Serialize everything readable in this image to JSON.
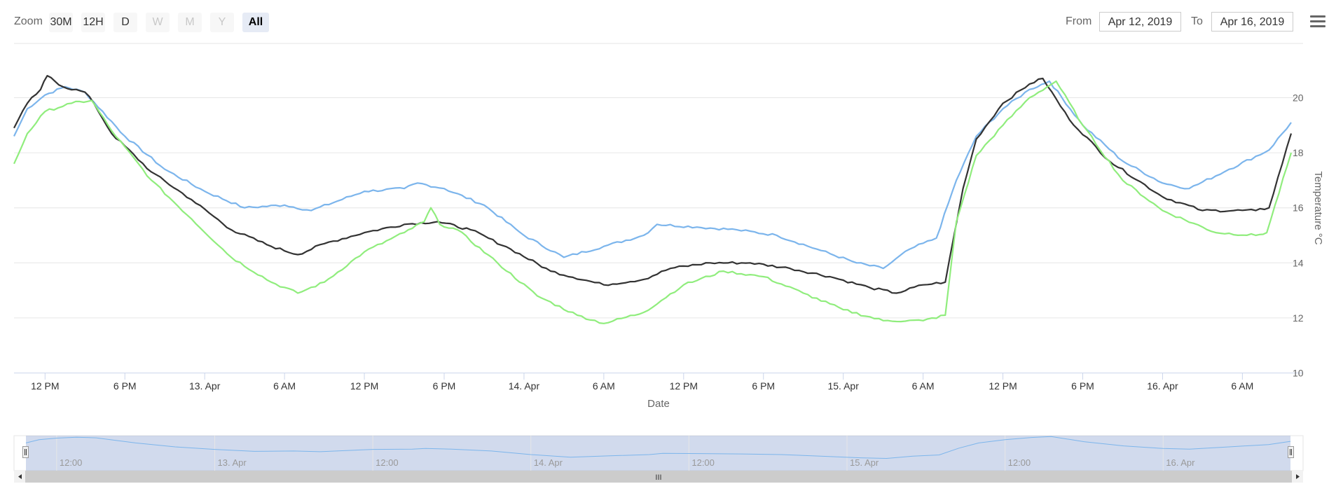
{
  "toolbar": {
    "zoom_label": "Zoom",
    "zoom_buttons": [
      "30M",
      "12H",
      "D",
      "W",
      "M",
      "Y",
      "All"
    ],
    "active_zoom": "All",
    "from_label": "From",
    "from_value": "Apr 12, 2019",
    "to_label": "To",
    "to_value": "Apr 16, 2019",
    "menu_icon": "hamburger-menu-icon"
  },
  "chart_data": {
    "type": "line",
    "xlabel": "Date",
    "ylabel": "Temperature °C",
    "xlim": [
      "2019-04-12T09:40",
      "2019-04-16T09:40"
    ],
    "ylim": [
      10,
      21
    ],
    "y_ticks": [
      10,
      12,
      14,
      16,
      18,
      20
    ],
    "x_tick_labels": [
      "12 PM",
      "6 PM",
      "13. Apr",
      "6 AM",
      "12 PM",
      "6 PM",
      "14. Apr",
      "6 AM",
      "12 PM",
      "6 PM",
      "15. Apr",
      "6 AM",
      "12 PM",
      "6 PM",
      "16. Apr",
      "6 AM"
    ],
    "grid": true,
    "legend": "none",
    "series": [
      {
        "color": "#7cb5ec",
        "points": [
          [
            "2019-04-12T09:40",
            18.6
          ],
          [
            "2019-04-12T10:40",
            19.6
          ],
          [
            "2019-04-12T12:00",
            20.1
          ],
          [
            "2019-04-12T13:30",
            20.4
          ],
          [
            "2019-04-12T15:00",
            20.2
          ],
          [
            "2019-04-12T18:00",
            18.6
          ],
          [
            "2019-04-12T21:00",
            17.4
          ],
          [
            "2019-04-13T00:00",
            16.6
          ],
          [
            "2019-04-13T03:00",
            16.0
          ],
          [
            "2019-04-13T06:00",
            16.1
          ],
          [
            "2019-04-13T08:00",
            15.9
          ],
          [
            "2019-04-13T12:00",
            16.6
          ],
          [
            "2019-04-13T15:00",
            16.7
          ],
          [
            "2019-04-13T16:00",
            16.9
          ],
          [
            "2019-04-13T18:00",
            16.7
          ],
          [
            "2019-04-13T21:00",
            16.1
          ],
          [
            "2019-04-14T00:00",
            15.0
          ],
          [
            "2019-04-14T03:00",
            14.2
          ],
          [
            "2019-04-14T06:00",
            14.6
          ],
          [
            "2019-04-14T09:00",
            15.0
          ],
          [
            "2019-04-14T10:00",
            15.4
          ],
          [
            "2019-04-14T13:00",
            15.3
          ],
          [
            "2019-04-14T16:00",
            15.2
          ],
          [
            "2019-04-14T19:00",
            15.0
          ],
          [
            "2019-04-14T22:00",
            14.5
          ],
          [
            "2019-04-15T01:00",
            14.0
          ],
          [
            "2019-04-15T03:00",
            13.8
          ],
          [
            "2019-04-15T05:00",
            14.5
          ],
          [
            "2019-04-15T07:00",
            14.9
          ],
          [
            "2019-04-15T08:30",
            17.0
          ],
          [
            "2019-04-15T10:00",
            18.6
          ],
          [
            "2019-04-15T12:00",
            19.6
          ],
          [
            "2019-04-15T14:00",
            20.3
          ],
          [
            "2019-04-15T15:30",
            20.6
          ],
          [
            "2019-04-15T18:00",
            19.0
          ],
          [
            "2019-04-15T21:00",
            17.7
          ],
          [
            "2019-04-16T00:00",
            16.9
          ],
          [
            "2019-04-16T02:00",
            16.7
          ],
          [
            "2019-04-16T05:00",
            17.4
          ],
          [
            "2019-04-16T08:00",
            18.1
          ],
          [
            "2019-04-16T09:40",
            19.1
          ]
        ]
      },
      {
        "color": "#333333",
        "points": [
          [
            "2019-04-12T09:40",
            18.9
          ],
          [
            "2019-04-12T10:40",
            19.8
          ],
          [
            "2019-04-12T11:40",
            20.3
          ],
          [
            "2019-04-12T12:10",
            20.8
          ],
          [
            "2019-04-12T13:20",
            20.4
          ],
          [
            "2019-04-12T15:00",
            20.2
          ],
          [
            "2019-04-12T15:40",
            19.8
          ],
          [
            "2019-04-12T17:00",
            18.7
          ],
          [
            "2019-04-12T20:00",
            17.3
          ],
          [
            "2019-04-12T23:00",
            16.3
          ],
          [
            "2019-04-13T02:00",
            15.2
          ],
          [
            "2019-04-13T05:00",
            14.6
          ],
          [
            "2019-04-13T07:00",
            14.3
          ],
          [
            "2019-04-13T09:00",
            14.7
          ],
          [
            "2019-04-13T12:00",
            15.1
          ],
          [
            "2019-04-13T15:00",
            15.4
          ],
          [
            "2019-04-13T17:30",
            15.5
          ],
          [
            "2019-04-13T20:00",
            15.2
          ],
          [
            "2019-04-13T23:00",
            14.5
          ],
          [
            "2019-04-14T02:00",
            13.7
          ],
          [
            "2019-04-14T06:00",
            13.2
          ],
          [
            "2019-04-14T09:00",
            13.4
          ],
          [
            "2019-04-14T11:00",
            13.8
          ],
          [
            "2019-04-14T14:00",
            14.0
          ],
          [
            "2019-04-14T17:00",
            14.0
          ],
          [
            "2019-04-14T20:00",
            13.8
          ],
          [
            "2019-04-14T23:00",
            13.5
          ],
          [
            "2019-04-15T02:00",
            13.1
          ],
          [
            "2019-04-15T04:00",
            12.9
          ],
          [
            "2019-04-15T06:00",
            13.2
          ],
          [
            "2019-04-15T07:40",
            13.3
          ],
          [
            "2019-04-15T09:00",
            16.7
          ],
          [
            "2019-04-15T10:00",
            18.5
          ],
          [
            "2019-04-15T12:00",
            19.8
          ],
          [
            "2019-04-15T14:00",
            20.5
          ],
          [
            "2019-04-15T15:00",
            20.7
          ],
          [
            "2019-04-15T17:00",
            19.2
          ],
          [
            "2019-04-15T20:00",
            17.7
          ],
          [
            "2019-04-16T00:00",
            16.4
          ],
          [
            "2019-04-16T03:00",
            15.9
          ],
          [
            "2019-04-16T07:00",
            15.9
          ],
          [
            "2019-04-16T08:00",
            16.0
          ],
          [
            "2019-04-16T09:40",
            18.7
          ]
        ]
      },
      {
        "color": "#90ed7d",
        "points": [
          [
            "2019-04-12T09:40",
            17.6
          ],
          [
            "2019-04-12T10:40",
            18.7
          ],
          [
            "2019-04-12T12:00",
            19.5
          ],
          [
            "2019-04-12T14:00",
            19.8
          ],
          [
            "2019-04-12T15:30",
            19.9
          ],
          [
            "2019-04-12T17:00",
            18.8
          ],
          [
            "2019-04-12T20:00",
            17.0
          ],
          [
            "2019-04-12T23:00",
            15.6
          ],
          [
            "2019-04-13T02:00",
            14.2
          ],
          [
            "2019-04-13T05:00",
            13.3
          ],
          [
            "2019-04-13T07:00",
            12.9
          ],
          [
            "2019-04-13T09:00",
            13.3
          ],
          [
            "2019-04-13T12:00",
            14.4
          ],
          [
            "2019-04-13T15:00",
            15.1
          ],
          [
            "2019-04-13T16:30",
            15.5
          ],
          [
            "2019-04-13T17:00",
            16.0
          ],
          [
            "2019-04-13T17:40",
            15.4
          ],
          [
            "2019-04-13T19:00",
            15.2
          ],
          [
            "2019-04-13T22:00",
            14.0
          ],
          [
            "2019-04-14T01:00",
            12.8
          ],
          [
            "2019-04-14T04:00",
            12.1
          ],
          [
            "2019-04-14T06:00",
            11.8
          ],
          [
            "2019-04-14T09:00",
            12.2
          ],
          [
            "2019-04-14T12:00",
            13.2
          ],
          [
            "2019-04-14T15:00",
            13.7
          ],
          [
            "2019-04-14T18:00",
            13.5
          ],
          [
            "2019-04-14T21:00",
            12.9
          ],
          [
            "2019-04-15T00:00",
            12.3
          ],
          [
            "2019-04-15T03:00",
            11.9
          ],
          [
            "2019-04-15T06:00",
            11.9
          ],
          [
            "2019-04-15T07:40",
            12.1
          ],
          [
            "2019-04-15T08:30",
            15.5
          ],
          [
            "2019-04-15T10:00",
            17.9
          ],
          [
            "2019-04-15T12:00",
            19.0
          ],
          [
            "2019-04-15T14:00",
            20.0
          ],
          [
            "2019-04-15T16:00",
            20.6
          ],
          [
            "2019-04-15T18:00",
            19.0
          ],
          [
            "2019-04-15T21:00",
            17.0
          ],
          [
            "2019-04-16T00:00",
            15.9
          ],
          [
            "2019-04-16T04:00",
            15.1
          ],
          [
            "2019-04-16T07:00",
            15.0
          ],
          [
            "2019-04-16T07:50",
            15.1
          ],
          [
            "2019-04-16T09:40",
            18.0
          ]
        ]
      }
    ]
  },
  "navigator": {
    "labels": [
      "12:00",
      "13. Apr",
      "12:00",
      "14. Apr",
      "12:00",
      "15. Apr",
      "12:00",
      "16. Apr"
    ],
    "scrollbar_grip": "III"
  }
}
